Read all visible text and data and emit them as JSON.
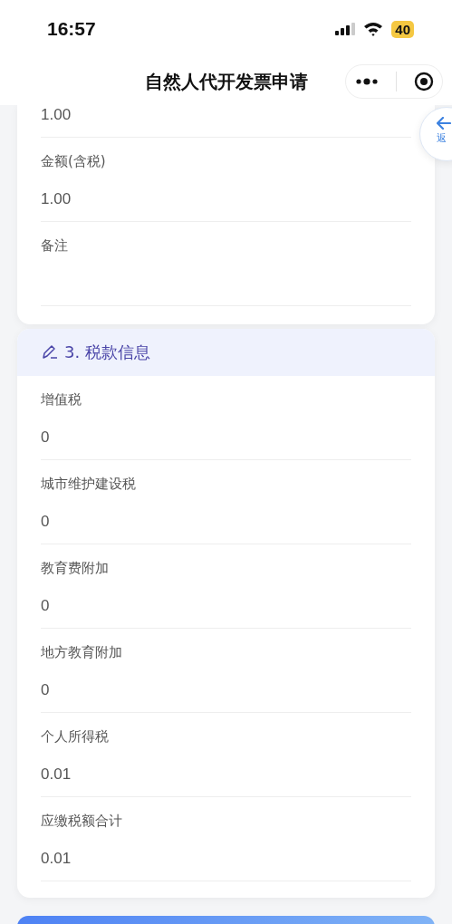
{
  "status_bar": {
    "time": "16:57",
    "battery": "40"
  },
  "nav": {
    "title": "自然人代开发票申请"
  },
  "back_button": {
    "label": "返"
  },
  "amount_card": {
    "partial_value": "1.00",
    "fields": [
      {
        "label": "金额(含税)",
        "value": "1.00"
      },
      {
        "label": "备注"
      }
    ]
  },
  "tax_section": {
    "title": "3. 税款信息",
    "fields": [
      {
        "label": "增值税",
        "value": "0"
      },
      {
        "label": "城市维护建设税",
        "value": "0"
      },
      {
        "label": "教育费附加",
        "value": "0"
      },
      {
        "label": "地方教育附加",
        "value": "0"
      },
      {
        "label": "个人所得税",
        "value": "0.01"
      },
      {
        "label": "应缴税额合计",
        "value": "0.01"
      }
    ]
  }
}
